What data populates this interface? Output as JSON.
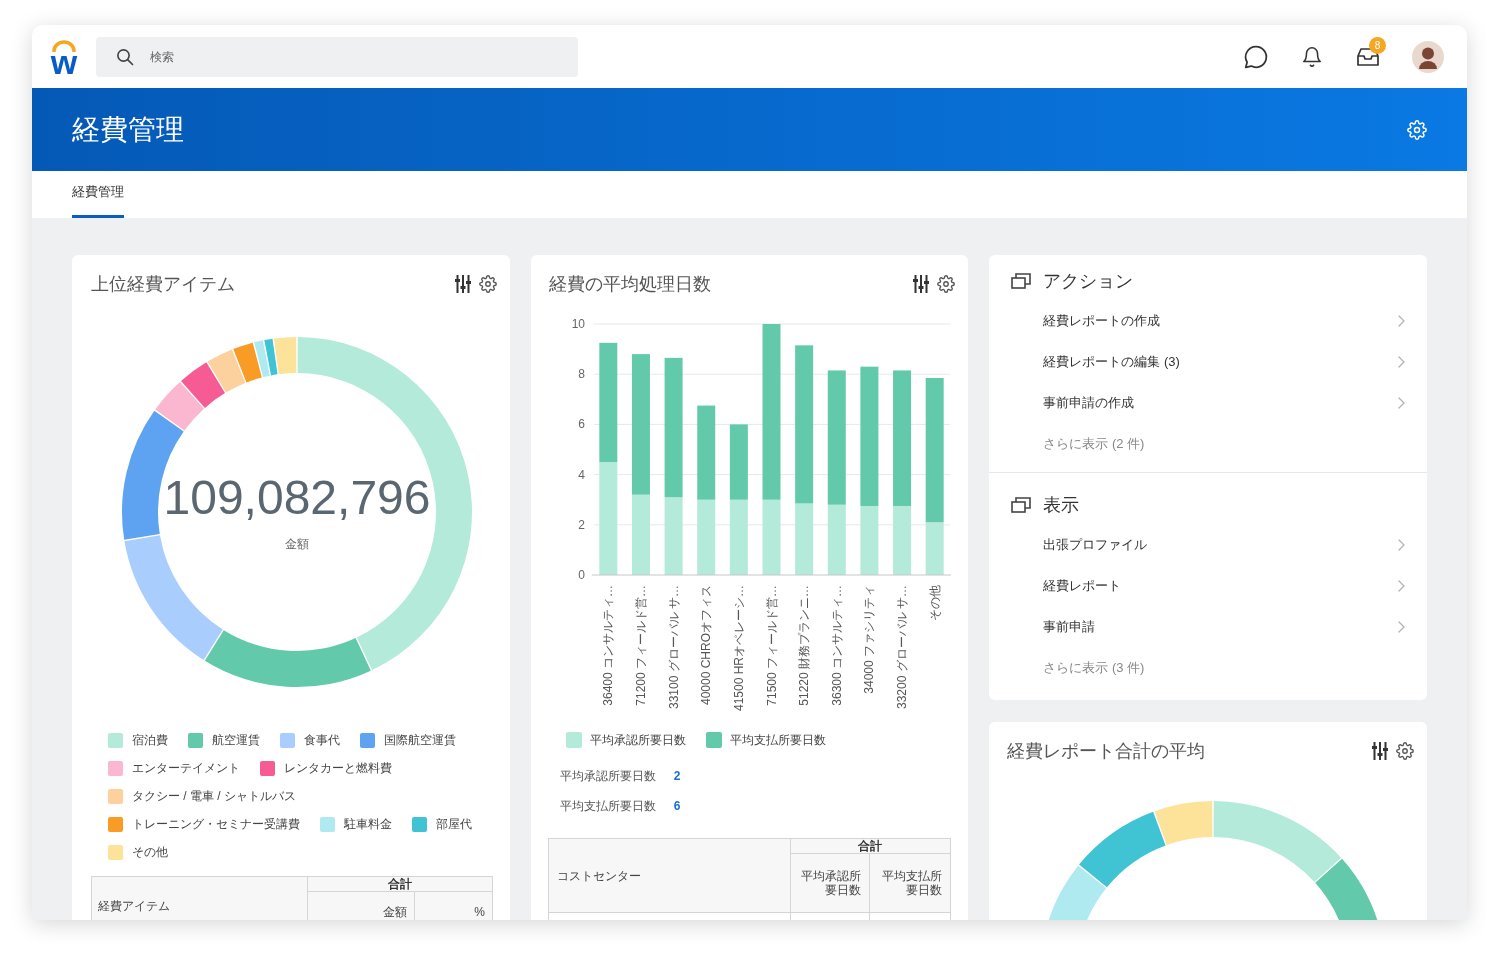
{
  "top_bar": {
    "logo": "w",
    "search": {
      "placeholder": "検索"
    },
    "inbox_badge": "8"
  },
  "header": {
    "title": "経費管理"
  },
  "tabs": [
    {
      "label": "経費管理",
      "selected": true
    }
  ],
  "top_expense_items": {
    "title": "上位経費アイテム",
    "total": "109,082,796",
    "total_label": "金額",
    "legend": [
      {
        "label": "宿泊費",
        "color": "#b3ead9"
      },
      {
        "label": "航空運賃",
        "color": "#63c9ab"
      },
      {
        "label": "食事代",
        "color": "#a9cdfd"
      },
      {
        "label": "国際航空運賃",
        "color": "#5ea2f2"
      },
      {
        "label": "エンターテイメント",
        "color": "#fbb7d0"
      },
      {
        "label": "レンタカーと燃料費",
        "color": "#f65b93"
      },
      {
        "label": "タクシー / 電車 / シャトルバス",
        "color": "#fcd19e"
      },
      {
        "label": "トレーニング・セミナー受講費",
        "color": "#f99c26"
      },
      {
        "label": "駐車料金",
        "color": "#aeeaf0"
      },
      {
        "label": "部屋代",
        "color": "#40c4d4"
      },
      {
        "label": "その他",
        "color": "#fde39a"
      }
    ],
    "table": {
      "row_header": "経費アイテム",
      "group_header": "合計",
      "group_columns": [
        "金額",
        "%"
      ]
    }
  },
  "average_processing_days": {
    "title": "経費の平均処理日数",
    "chart_data": {
      "type": "bar",
      "stacked": true,
      "grid": true,
      "categories": [
        "36400 コンサルティ…",
        "71200 フィールド営…",
        "33100 グローバル サ…",
        "40000 CHROオフィス",
        "41500 HRオペレーシ…",
        "71500 フィールド営…",
        "51220 財務プランニ…",
        "36300 コンサルティ…",
        "34000 ファシリティ",
        "33200 グローバル サ…",
        "その他"
      ],
      "series": [
        {
          "name": "平均承認所要日数",
          "color": "#b3ead9",
          "values": [
            4.5,
            3.2,
            3.1,
            3.0,
            3.0,
            3.0,
            2.85,
            2.8,
            2.75,
            2.75,
            2.1
          ]
        },
        {
          "name": "平均支払所要日数",
          "color": "#63c9ab",
          "values": [
            4.75,
            5.6,
            5.55,
            3.75,
            3.0,
            7.0,
            6.3,
            5.35,
            5.55,
            5.4,
            5.75
          ]
        }
      ],
      "ylim": [
        0,
        10
      ],
      "yticks": [
        0,
        2,
        4,
        6,
        8,
        10
      ]
    },
    "summary": [
      {
        "label": "平均承認所要日数",
        "value": "2"
      },
      {
        "label": "平均支払所要日数",
        "value": "6"
      }
    ],
    "table": {
      "row_header": "コストセンター",
      "group_header": "合計",
      "group_columns": [
        "平均承認所要日数",
        "平均支払所要日数"
      ]
    }
  },
  "links_panel": {
    "sections": [
      {
        "title": "アクション",
        "items": [
          "経費レポートの作成",
          "経費レポートの編集 (3)",
          "事前申請の作成"
        ],
        "more": "さらに表示 (2 件)"
      },
      {
        "title": "表示",
        "items": [
          "出張プロファイル",
          "経費レポート",
          "事前申請"
        ],
        "more": "さらに表示 (3 件)"
      }
    ]
  },
  "average_report_total": {
    "title": "経費レポート合計の平均"
  }
}
